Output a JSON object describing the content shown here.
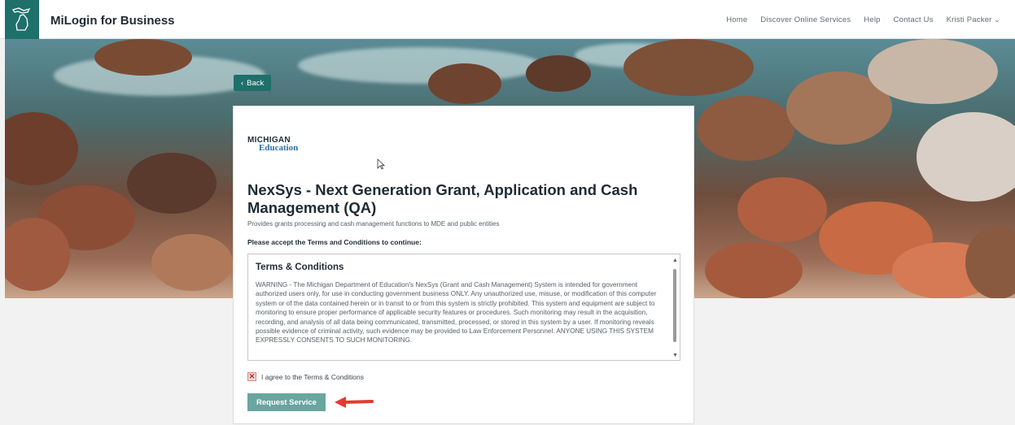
{
  "header": {
    "title": "MiLogin for Business",
    "nav": [
      "Home",
      "Discover Online Services",
      "Help",
      "Contact Us"
    ],
    "user_name": "Kristi Packer"
  },
  "back_button": {
    "label": "Back"
  },
  "card": {
    "logo": {
      "top": "MICHIGAN",
      "bottom": "Education"
    },
    "service_title": "NexSys - Next Generation Grant, Application and Cash Management (QA)",
    "service_description": "Provides grants processing and cash management functions to MDE and public entities",
    "accept_prompt": "Please accept the Terms and Conditions to continue:",
    "terms": {
      "heading": "Terms & Conditions",
      "body": "WARNING - The Michigan Department of Education's NexSys (Grant and Cash Management) System is intended for government authorized users only, for use in conducting government business ONLY. Any unauthorized use, misuse, or modification of this computer system or of the data contained herein or in transit to or from this system is strictly prohibited. This system and equipment are subject to monitoring to ensure proper performance of applicable security features or procedures. Such monitoring may result in the acquisition, recording, and analysis of all data being communicated, transmitted, processed, or stored in this system by a user. If monitoring reveals possible evidence of criminal activity, such evidence may be provided to Law Enforcement Personnel. ANYONE USING THIS SYSTEM EXPRESSLY CONSENTS TO SUCH MONITORING."
    },
    "agree_label": "I agree to the Terms & Conditions",
    "agree_checked": true,
    "request_button": "Request Service"
  },
  "colors": {
    "brand_teal": "#1f6f6b",
    "request_button": "#6aa5a0",
    "annotation_arrow": "#e03c31"
  }
}
